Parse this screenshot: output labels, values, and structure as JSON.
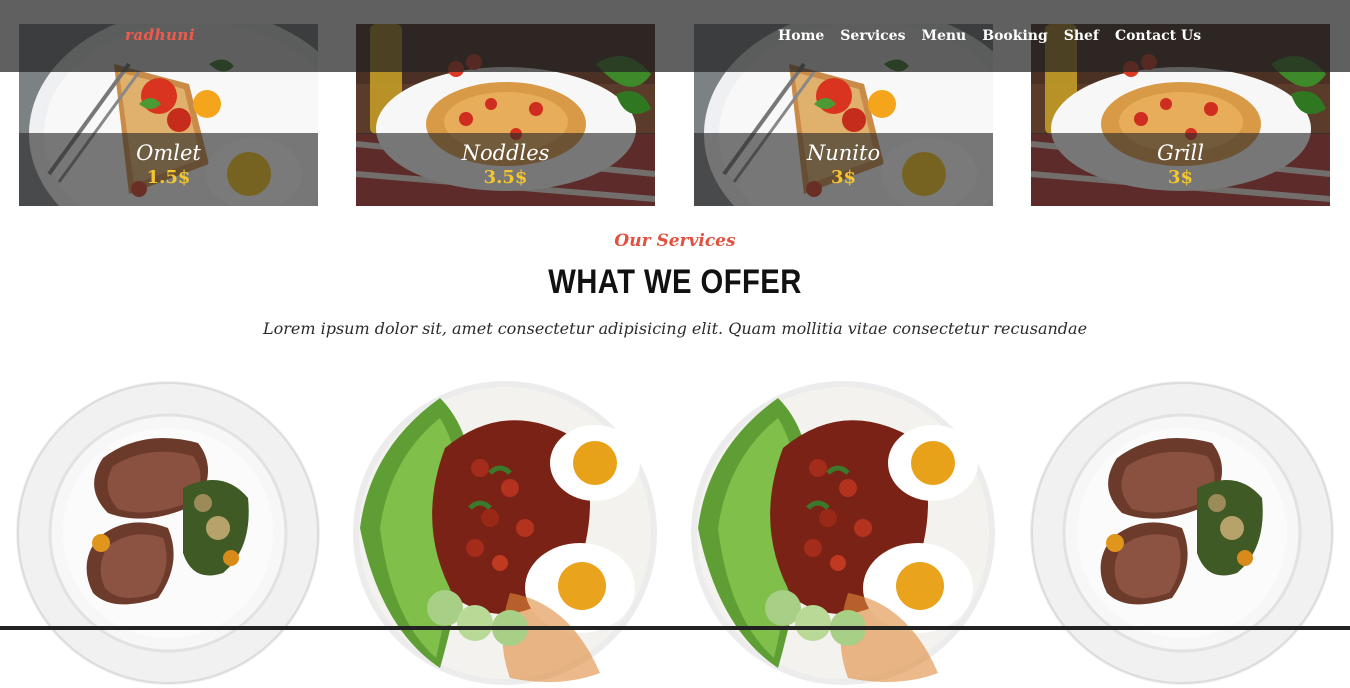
{
  "nav": {
    "brand": "radhuni",
    "links": [
      "Home",
      "Services",
      "Menu",
      "Booking",
      "Shef",
      "Contact Us"
    ]
  },
  "menu_cards": [
    {
      "name": "Omlet",
      "price": "1.5$",
      "image": "eggs-toast-plate"
    },
    {
      "name": "Noddles",
      "price": "3.5$",
      "image": "spaghetti-plate"
    },
    {
      "name": "Nunito",
      "price": "3$",
      "image": "eggs-toast-plate"
    },
    {
      "name": "Grill",
      "price": "3$",
      "image": "spaghetti-plate"
    }
  ],
  "services": {
    "subtitle": "Our Services",
    "title": "WHAT WE OFFER",
    "description": "Lorem ipsum dolor sit, amet consectetur adipisicing elit. Quam mollitia vitae consectetur recusandae"
  },
  "plates": [
    {
      "image": "steak-plate"
    },
    {
      "image": "beans-eggs-salad-plate"
    },
    {
      "image": "beans-eggs-salad-plate"
    },
    {
      "image": "steak-plate"
    }
  ],
  "colors": {
    "brand": "#f25a4a",
    "price": "#f6c62c",
    "accent": "#e0513f",
    "nav_bg": "#232323"
  }
}
